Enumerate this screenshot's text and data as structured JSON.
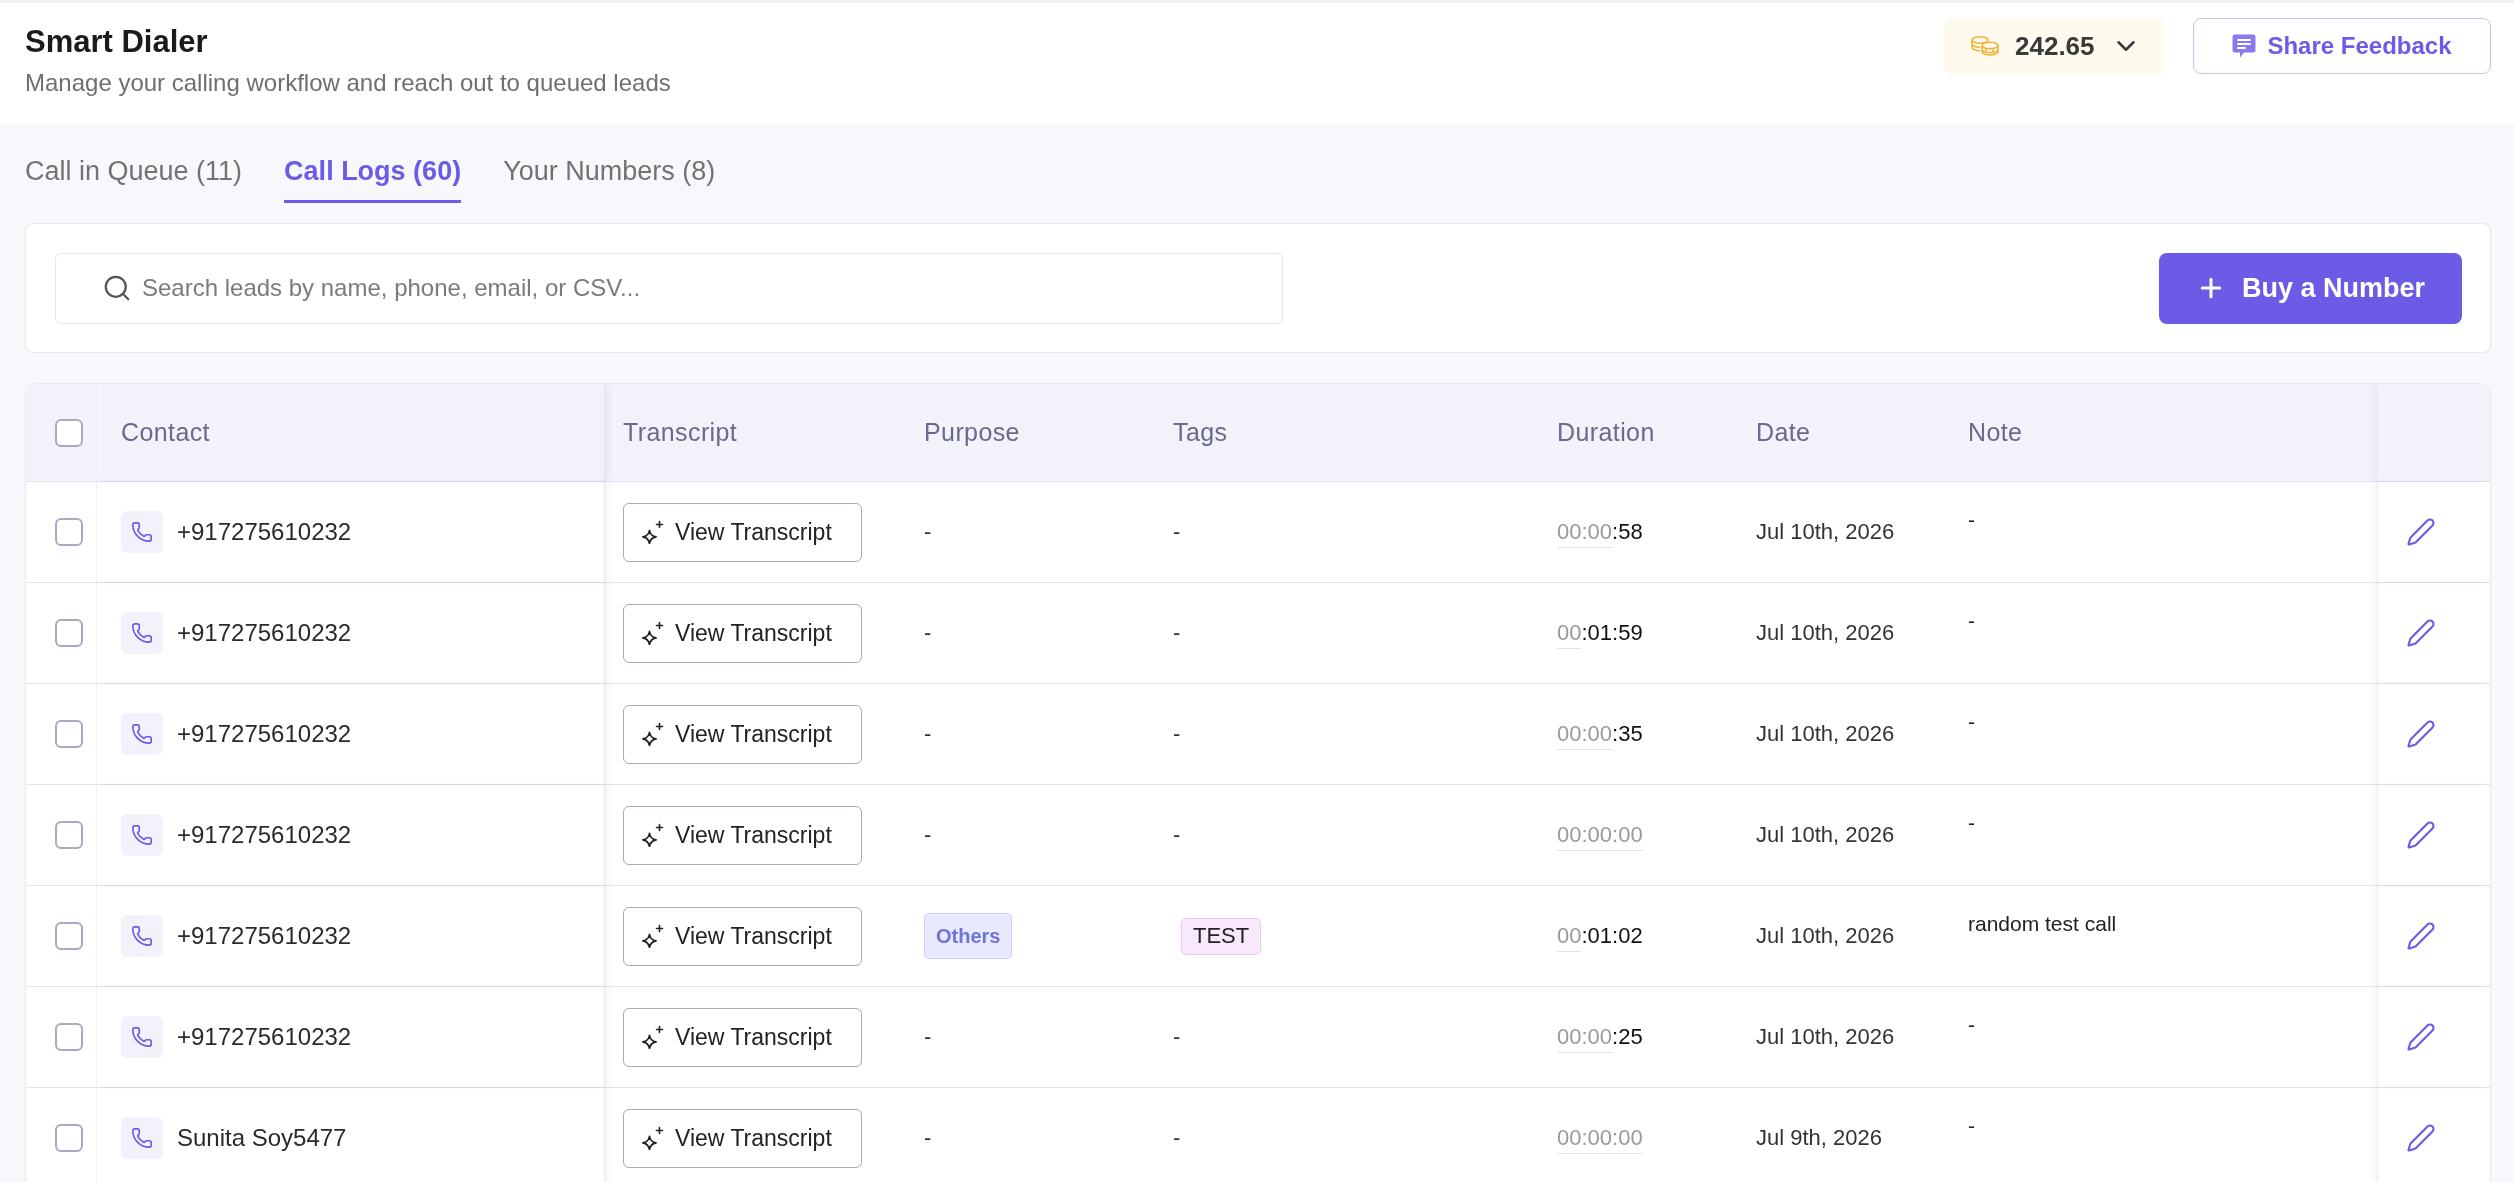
{
  "header": {
    "title": "Smart Dialer",
    "subtitle": "Manage your calling workflow and reach out to queued leads",
    "balance": "242.65",
    "feedback_button": "Share Feedback"
  },
  "tabs": [
    {
      "label": "Call in Queue (11)",
      "selected": false
    },
    {
      "label": "Call Logs (60)",
      "selected": true
    },
    {
      "label": "Your Numbers (8)",
      "selected": false
    }
  ],
  "search": {
    "placeholder": "Search leads by name, phone, email, or CSV..."
  },
  "buy_button": "Buy a Number",
  "table": {
    "select_all_checked": false,
    "columns": [
      "Contact",
      "Transcript",
      "Purpose",
      "Tags",
      "Duration",
      "Date",
      "Note"
    ],
    "rows": [
      {
        "checked": false,
        "contact": "+917275610232",
        "transcript_button": "View Transcript",
        "purpose": {
          "kind": "empty",
          "text": "-"
        },
        "tags": {
          "kind": "empty",
          "text": "-"
        },
        "duration": {
          "dim": "00:00",
          "bright": ":58"
        },
        "date": "Jul 10th, 2026",
        "note": "-"
      },
      {
        "checked": false,
        "contact": "+917275610232",
        "transcript_button": "View Transcript",
        "purpose": {
          "kind": "empty",
          "text": "-"
        },
        "tags": {
          "kind": "empty",
          "text": "-"
        },
        "duration": {
          "dim": "00",
          "bright": ":01:59"
        },
        "date": "Jul 10th, 2026",
        "note": "-"
      },
      {
        "checked": false,
        "contact": "+917275610232",
        "transcript_button": "View Transcript",
        "purpose": {
          "kind": "empty",
          "text": "-"
        },
        "tags": {
          "kind": "empty",
          "text": "-"
        },
        "duration": {
          "dim": "00:00",
          "bright": ":35"
        },
        "date": "Jul 10th, 2026",
        "note": "-"
      },
      {
        "checked": false,
        "contact": "+917275610232",
        "transcript_button": "View Transcript",
        "purpose": {
          "kind": "empty",
          "text": "-"
        },
        "tags": {
          "kind": "empty",
          "text": "-"
        },
        "duration": {
          "dim": "00:00:00"
        },
        "date": "Jul 10th, 2026",
        "note": "-"
      },
      {
        "checked": false,
        "contact": "+917275610232",
        "transcript_button": "View Transcript",
        "purpose": {
          "kind": "badge",
          "text": "Others"
        },
        "tags": {
          "kind": "badge",
          "text": "TEST"
        },
        "duration": {
          "dim": "00",
          "bright": ":01:02"
        },
        "date": "Jul 10th, 2026",
        "note": "random test call"
      },
      {
        "checked": false,
        "contact": "+917275610232",
        "transcript_button": "View Transcript",
        "purpose": {
          "kind": "empty",
          "text": "-"
        },
        "tags": {
          "kind": "empty",
          "text": "-"
        },
        "duration": {
          "dim": "00:00",
          "bright": ":25"
        },
        "date": "Jul 10th, 2026",
        "note": "-"
      },
      {
        "checked": false,
        "contact": "Sunita Soy5477",
        "transcript_button": "View Transcript",
        "purpose": {
          "kind": "empty",
          "text": "-"
        },
        "tags": {
          "kind": "empty",
          "text": "-"
        },
        "duration": {
          "dim": "00:00:00"
        },
        "date": "Jul 9th, 2026",
        "note": "-"
      }
    ]
  }
}
